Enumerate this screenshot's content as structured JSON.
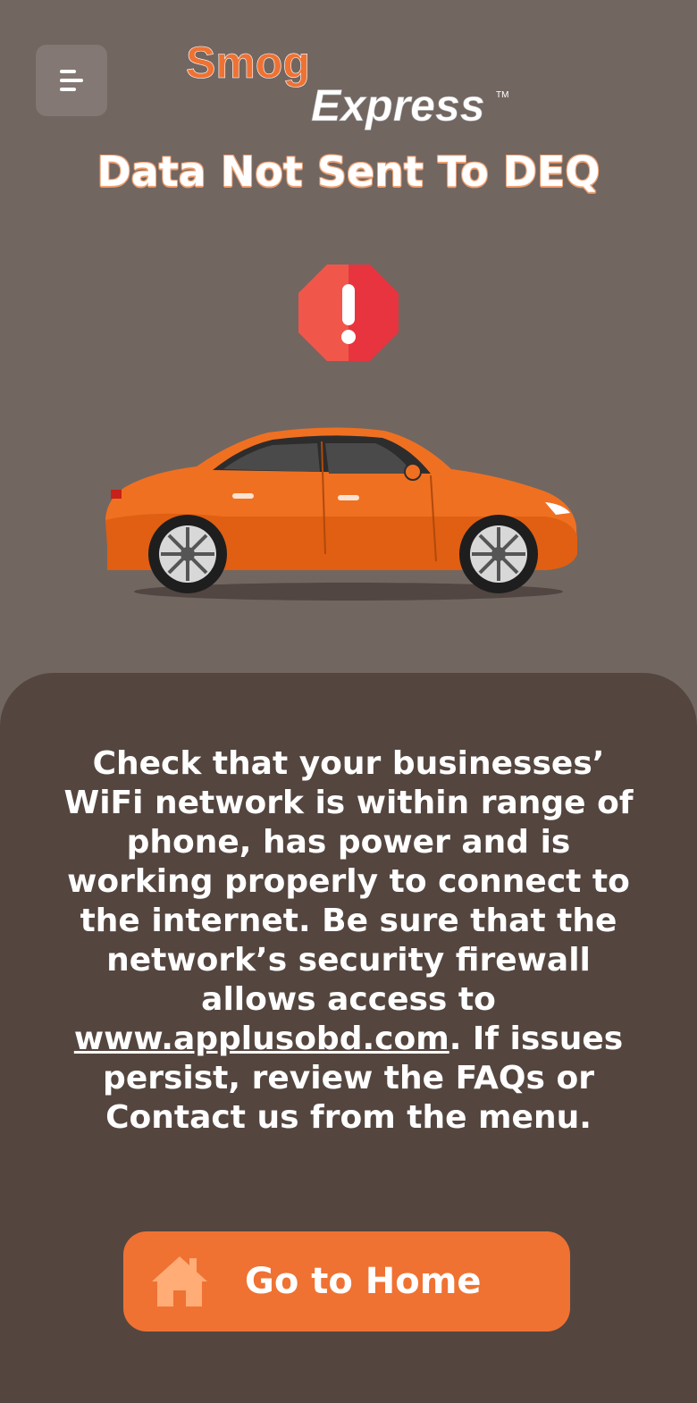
{
  "header": {
    "menu_icon": "hamburger-menu-icon",
    "logo_line1": "Smog",
    "logo_line2": "Express",
    "logo_tm": "TM"
  },
  "status": {
    "title": "Data Not Sent To DEQ",
    "alert_icon": "alert-octagon-icon",
    "illustration": "orange-sedan-car"
  },
  "message": {
    "part1": "Check that your businesses’ WiFi network is within range of phone, has power and is working properly to connect to the internet.  Be sure that the network’s security firewall allows access to ",
    "link": "www.applusobd.com",
    "part2": ".  If issues persist, review the FAQs or Contact us from the menu."
  },
  "home_button": {
    "label": "Go to Home",
    "icon": "home-icon"
  },
  "colors": {
    "background": "#726661",
    "panel": "#54463f",
    "accent": "#ef7233",
    "alert_red": "#e8343f"
  }
}
